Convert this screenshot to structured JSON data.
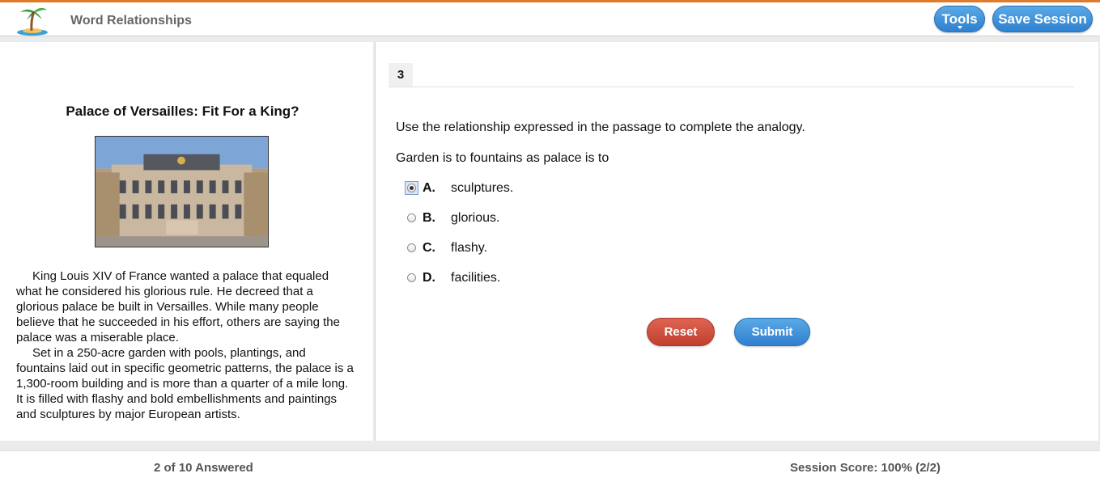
{
  "header": {
    "app_title": "Word Relationships",
    "tools_label": "Tools",
    "save_label": "Save Session",
    "accent_color": "#e07b2c"
  },
  "passage": {
    "title": "Palace of Versailles: Fit For a King?",
    "image_icon": "palace-photo",
    "paragraphs": [
      "King Louis XIV of France wanted a palace that equaled what he considered his glorious rule. He decreed that a glorious palace be built in Versailles. While many people believe that he succeeded in his effort, others are saying the palace was a miserable place.",
      "Set in a 250-acre garden with pools, plantings, and fountains laid out in specific geometric patterns, the palace is a 1,300-room building and is more than a quarter of a mile long. It is filled with flashy and bold embellishments and paintings and sculptures by major European artists."
    ]
  },
  "question": {
    "number": "3",
    "prompt": "Use the relationship expressed in the passage to complete the analogy.",
    "stem": "Garden is to fountains as palace is to",
    "selected": "A",
    "choices": [
      {
        "letter": "A.",
        "text": "sculptures."
      },
      {
        "letter": "B.",
        "text": "glorious."
      },
      {
        "letter": "C.",
        "text": "flashy."
      },
      {
        "letter": "D.",
        "text": "facilities."
      }
    ],
    "reset_label": "Reset",
    "submit_label": "Submit"
  },
  "footer": {
    "answered": "2 of 10 Answered",
    "score": "Session Score: 100% (2/2)"
  }
}
